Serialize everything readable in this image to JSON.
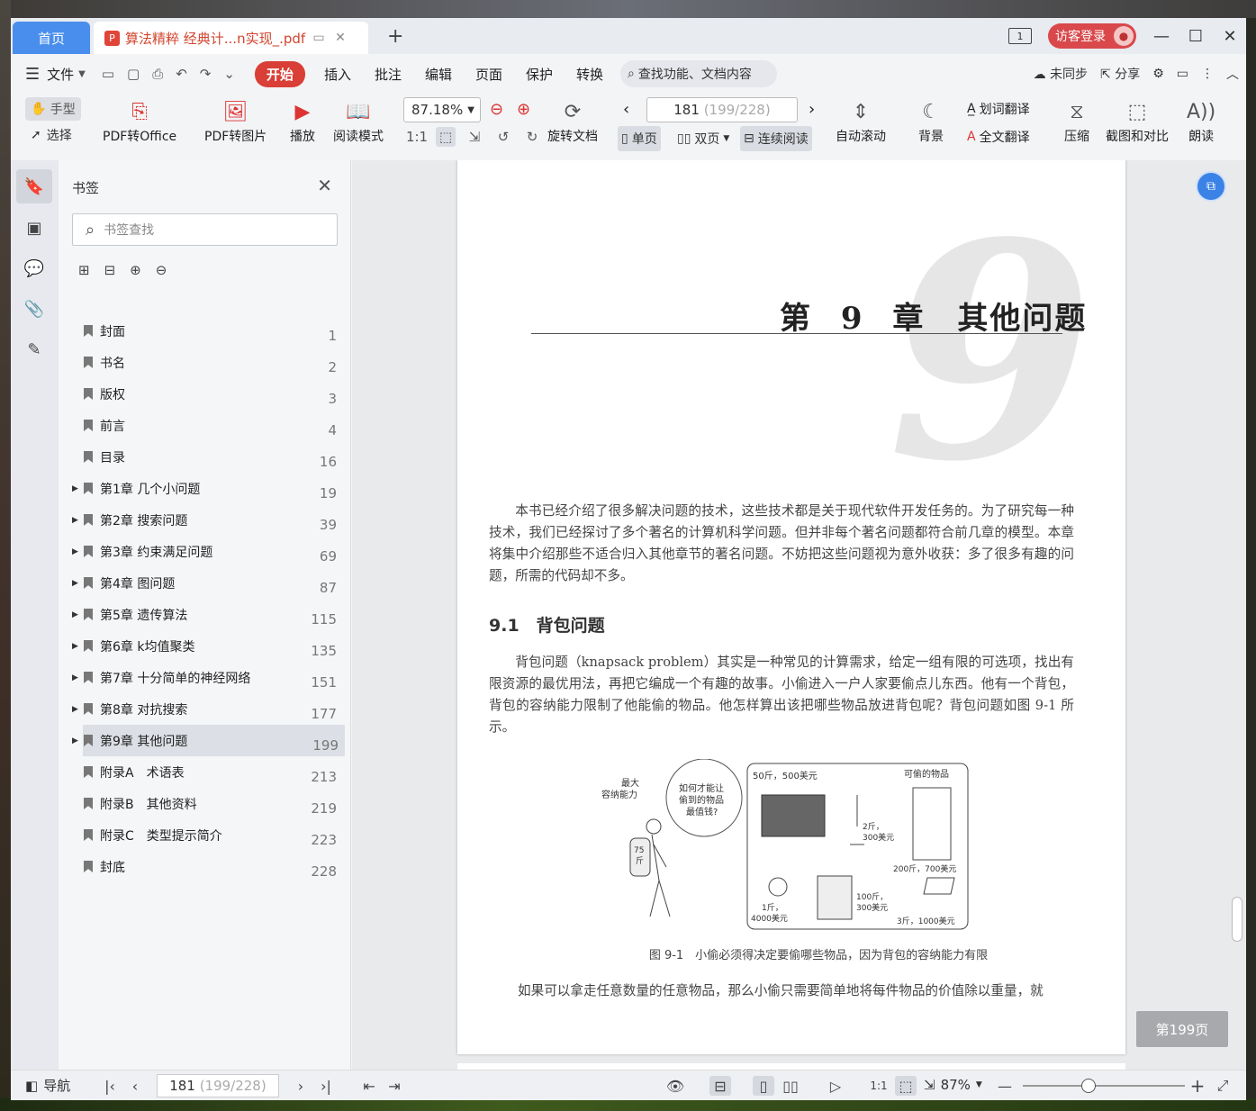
{
  "tabs": {
    "home": "首页",
    "doc_title": "算法精粹 经典计...n实现_.pdf",
    "add": "+"
  },
  "window": {
    "page_count_icon": "1",
    "visitor_login": "访客登录"
  },
  "menu": {
    "file": "文件",
    "start": "开始",
    "items": [
      "插入",
      "批注",
      "编辑",
      "页面",
      "保护",
      "转换"
    ],
    "search_placeholder": "查找功能、文档内容",
    "sync": "未同步",
    "share": "分享"
  },
  "toolbar": {
    "hand": "手型",
    "select": "选择",
    "pdf_to_office": "PDF转Office",
    "pdf_to_image": "PDF转图片",
    "play": "播放",
    "read_mode": "阅读模式",
    "zoom": "87.18%",
    "rotate": "旋转文档",
    "page_current": "181",
    "page_faint": "(199/228)",
    "single": "单页",
    "double": "双页",
    "continuous": "连续阅读",
    "auto_scroll": "自动滚动",
    "background": "背景",
    "word_translate": "划词翻译",
    "full_translate": "全文翻译",
    "compress": "压缩",
    "screenshot_compare": "截图和对比",
    "read_aloud": "朗读",
    "actual_size": "1:1"
  },
  "bookmarks": {
    "title": "书签",
    "search_placeholder": "书签查找",
    "items": [
      {
        "label": "封面",
        "page": "1",
        "expandable": false
      },
      {
        "label": "书名",
        "page": "2",
        "expandable": false
      },
      {
        "label": "版权",
        "page": "3",
        "expandable": false
      },
      {
        "label": "前言",
        "page": "4",
        "expandable": false
      },
      {
        "label": "目录",
        "page": "16",
        "expandable": false
      },
      {
        "label": "第1章 几个小问题",
        "page": "19",
        "expandable": true
      },
      {
        "label": "第2章 搜索问题",
        "page": "39",
        "expandable": true
      },
      {
        "label": "第3章 约束满足问题",
        "page": "69",
        "expandable": true
      },
      {
        "label": "第4章 图问题",
        "page": "87",
        "expandable": true
      },
      {
        "label": "第5章 遗传算法",
        "page": "115",
        "expandable": true
      },
      {
        "label": "第6章 k均值聚类",
        "page": "135",
        "expandable": true
      },
      {
        "label": "第7章 十分简单的神经网络",
        "page": "151",
        "expandable": true
      },
      {
        "label": "第8章 对抗搜索",
        "page": "177",
        "expandable": true
      },
      {
        "label": "第9章 其他问题",
        "page": "199",
        "expandable": true,
        "selected": true
      },
      {
        "label": "附录A　术语表",
        "page": "213",
        "expandable": false
      },
      {
        "label": "附录B　其他资料",
        "page": "219",
        "expandable": false
      },
      {
        "label": "附录C　类型提示简介",
        "page": "223",
        "expandable": false
      },
      {
        "label": "封底",
        "page": "228",
        "expandable": false
      }
    ]
  },
  "document": {
    "chapter_number": "9",
    "chapter_title": "第 9 章　其他问题",
    "intro": "本书已经介绍了很多解决问题的技术，这些技术都是关于现代软件开发任务的。为了研究每一种技术，我们已经探讨了多个著名的计算机科学问题。但并非每个著名问题都符合前几章的模型。本章将集中介绍那些不适合归入其他章节的著名问题。不妨把这些问题视为意外收获：多了很多有趣的问题，所需的代码却不多。",
    "section_title": "9.1　背包问题",
    "section_text": "背包问题（knapsack problem）其实是一种常见的计算需求，给定一组有限的可选项，找出有限资源的最优用法，再把它编成一个有趣的故事。小偷进入一户人家要偷点儿东西。他有一个背包，背包的容纳能力限制了他能偷的物品。他怎样算出该把哪些物品放进背包呢？背包问题如图 9-1 所示。",
    "figure_labels": {
      "max_capacity_1": "最大",
      "max_capacity_2": "容纳能力",
      "thought_1": "如何才能让",
      "thought_2": "偷到的物品",
      "thought_3": "最值钱?",
      "weight": "75",
      "weight_unit": "斤",
      "tv": "50斤，500美元",
      "items_title": "可偷的物品",
      "candle_1": "2斤，",
      "candle_2": "300美元",
      "fridge": "200斤，700美元",
      "jewel_1": "1斤，",
      "jewel_2": "4000美元",
      "books_1": "100斤，",
      "books_2": "300美元",
      "laptop": "3斤，1000美元"
    },
    "figure_caption": "图 9-1　小偷必须得决定要偷哪些物品，因为背包的容纳能力有限",
    "last_line": "如果可以拿走任意数量的任意物品，那么小偷只需要简单地将每件物品的价值除以重量，就",
    "page_tag": "第199页"
  },
  "status": {
    "nav": "导航",
    "page_current": "181",
    "page_faint": "(199/228)",
    "zoom": "87%",
    "actual_size": "1:1"
  }
}
